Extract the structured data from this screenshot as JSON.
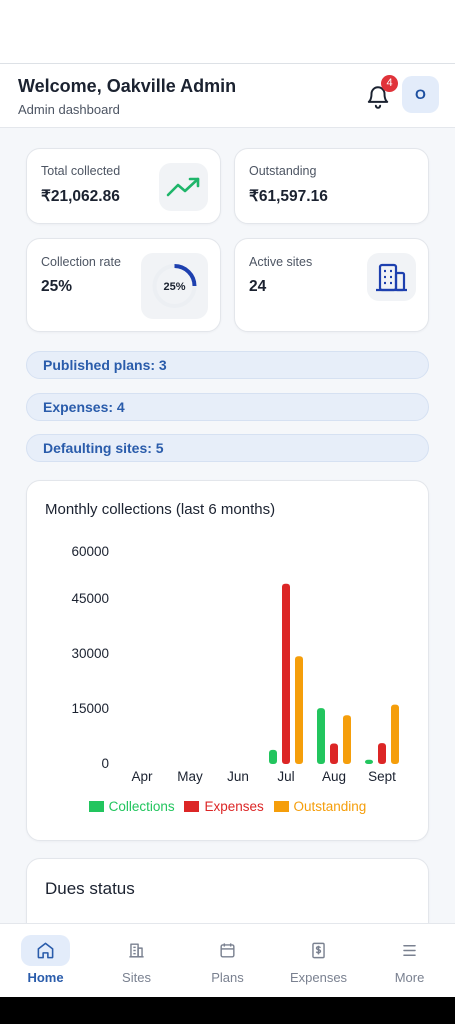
{
  "header": {
    "title": "Welcome, Oakville Admin",
    "subtitle": "Admin dashboard",
    "notification_count": "4",
    "avatar_initial": "O"
  },
  "stats": {
    "total_collected": {
      "label": "Total collected",
      "value": "₹21,062.86",
      "icon": "trending-up-icon"
    },
    "outstanding": {
      "label": "Outstanding",
      "value": "₹61,597.16"
    },
    "collection_rate": {
      "label": "Collection rate",
      "value": "25%",
      "ring_label": "25%",
      "ring_fraction": 0.25
    },
    "active_sites": {
      "label": "Active sites",
      "value": "24",
      "icon": "building-icon"
    }
  },
  "pills": {
    "published_plans": "Published plans: 3",
    "expenses": "Expenses: 4",
    "defaulting_sites": "Defaulting sites: 5"
  },
  "colors": {
    "collections": "#22c55e",
    "expenses": "#dc2626",
    "outstanding": "#f59e0b",
    "accent": "#2a5cab"
  },
  "chart_data": {
    "type": "bar",
    "title": "Monthly collections (last 6 months)",
    "categories": [
      "Apr",
      "May",
      "Jun",
      "Jul",
      "Aug",
      "Sept"
    ],
    "ylim": [
      0,
      60000
    ],
    "yticks": [
      "60000",
      "45000",
      "30000",
      "15000",
      "0"
    ],
    "grid": false,
    "legend_position": "bottom",
    "series": [
      {
        "name": "Collections",
        "values": [
          0,
          0,
          0,
          4000,
          15800,
          1200
        ]
      },
      {
        "name": "Expenses",
        "values": [
          0,
          0,
          0,
          51000,
          5800,
          5900
        ]
      },
      {
        "name": "Outstanding",
        "values": [
          0,
          0,
          0,
          30500,
          13800,
          16800
        ]
      }
    ]
  },
  "dues": {
    "title": "Dues status"
  },
  "nav": [
    {
      "label": "Home",
      "icon": "home-icon"
    },
    {
      "label": "Sites",
      "icon": "building-icon"
    },
    {
      "label": "Plans",
      "icon": "calendar-icon"
    },
    {
      "label": "Expenses",
      "icon": "dollar-receipt-icon"
    },
    {
      "label": "More",
      "icon": "menu-icon"
    }
  ]
}
